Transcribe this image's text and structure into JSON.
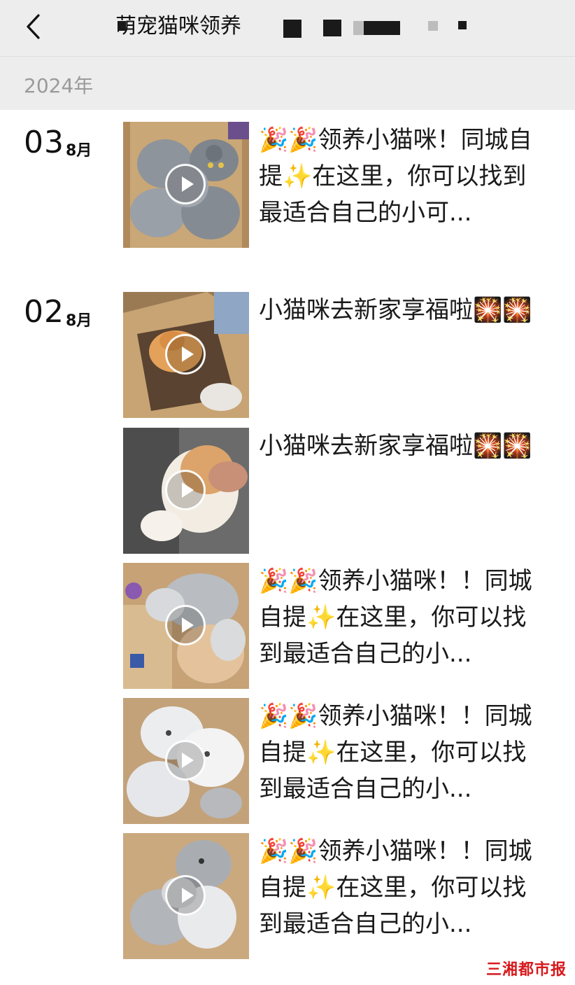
{
  "header": {
    "back_icon": "chevron-left-icon",
    "title": "萌宠猫咪领养"
  },
  "year_label": "2024年",
  "groups": [
    {
      "day": "03",
      "month": "8月",
      "posts": [
        {
          "text": "🎉🎉领养小猫咪！同城自提✨在这里，你可以找到最适合自己的小可..."
        }
      ]
    },
    {
      "day": "02",
      "month": "8月",
      "posts": [
        {
          "text": "小猫咪去新家享福啦🎇🎇"
        },
        {
          "text": "小猫咪去新家享福啦🎇🎇"
        },
        {
          "text": "🎉🎉领养小猫咪！！同城自提✨在这里，你可以找到最适合自己的小..."
        },
        {
          "text": "🎉🎉领养小猫咪！！同城自提✨在这里，你可以找到最适合自己的小..."
        },
        {
          "text": "🎉🎉领养小猫咪！！同城自提✨在这里，你可以找到最适合自己的小..."
        }
      ]
    }
  ],
  "watermark": "三湘都市报",
  "colors": {
    "header_bg": "#ededed",
    "watermark": "#d7191c"
  }
}
